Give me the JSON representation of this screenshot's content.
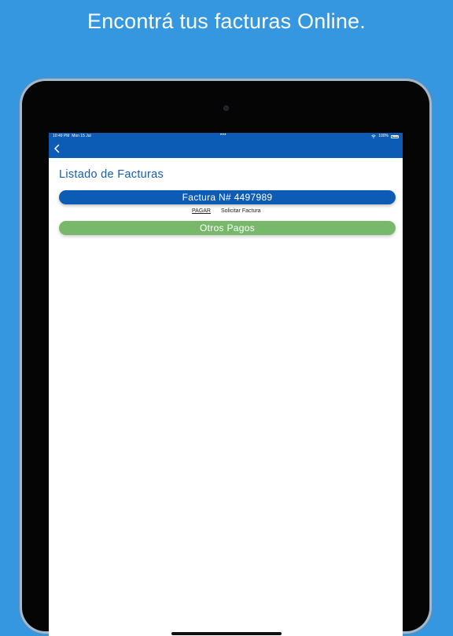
{
  "headline": "Encontrá tus facturas Online.",
  "status_bar": {
    "time": "10:49 PM",
    "date": "Mon 15 Jul",
    "dots": "•••",
    "battery": "100%"
  },
  "screen": {
    "title": "Listado de Facturas",
    "invoice_button_label": "Factura N# 4497989",
    "pay_label": "PAGAR",
    "request_label": "Solicitar Factura",
    "other_payments_label": "Otros Pagos"
  },
  "colors": {
    "background": "#3597e0",
    "primary_blue": "#0c5bb4",
    "title_blue": "#1a5ea8",
    "green": "#78b86a"
  },
  "icons": {
    "back": "chevron-left-icon",
    "wifi": "wifi-icon",
    "battery": "battery-icon"
  }
}
